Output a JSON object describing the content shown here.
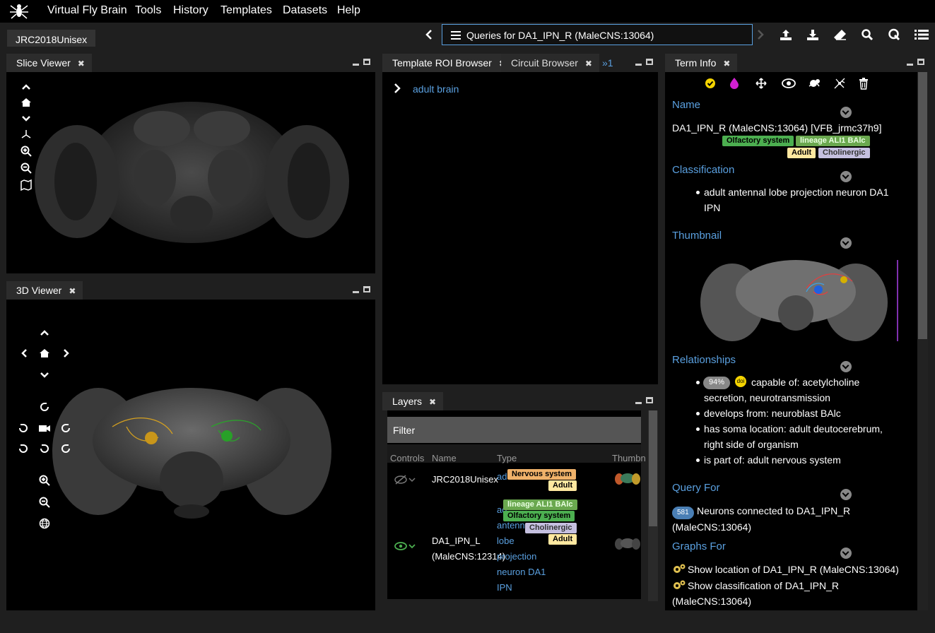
{
  "menu": {
    "app_name": "Virtual Fly Brain",
    "items": [
      "Tools",
      "History",
      "Templates",
      "Datasets",
      "Help"
    ]
  },
  "toolbar": {
    "template_tab": "JRC2018Unisex",
    "query_text": "Queries for DA1_IPN_R (MaleCNS:13064)"
  },
  "slice_viewer": {
    "title": "Slice Viewer"
  },
  "viewer3d": {
    "title": "3D Viewer"
  },
  "roi_browser": {
    "tabs": [
      "Template ROI Browser",
      "Circuit Browser"
    ],
    "overflow": "»1",
    "tree_item": "adult brain"
  },
  "layers": {
    "title": "Layers",
    "filter_label": "Filter",
    "columns": [
      "Controls",
      "Name",
      "Type",
      "Thumbn"
    ],
    "rows": [
      {
        "name": "JRC2018Unisex",
        "type_prefix": "ad",
        "tags": [
          "Nervous system",
          "Adult"
        ]
      },
      {
        "name_line1": "DA1_IPN_L",
        "name_line2": "(MaleCNS:12314)",
        "type_lines": [
          "ad",
          "antenna",
          "lobe",
          "projection",
          "neuron DA1",
          "IPN"
        ],
        "tags": [
          "lineage ALI1 BAlc",
          "Olfactory system",
          "Cholinergic",
          "Adult"
        ]
      }
    ]
  },
  "term_info": {
    "title": "Term Info",
    "name_header": "Name",
    "name_value": "DA1_IPN_R (MaleCNS:13064) [VFB_jrmc37h9]",
    "name_tags": [
      "Olfactory system",
      "lineage ALI1 BAlc",
      "Adult",
      "Cholinergic"
    ],
    "classification_header": "Classification",
    "classification_line1": "adult antennal lobe projection neuron DA1",
    "classification_line2": "IPN",
    "thumbnail_header": "Thumbnail",
    "relationships_header": "Relationships",
    "relationships": {
      "badge_pct": "94%",
      "badge_doi": "doi",
      "r1_line1": "capable of: acetylcholine",
      "r1_line2": "secretion, neurotransmission",
      "r2": "develops from: neuroblast BAlc",
      "r3_line1": "has soma location: adult deutocerebrum,",
      "r3_line2": "right side of organism",
      "r4": "is part of: adult nervous system"
    },
    "query_header": "Query For",
    "query_count": "581",
    "query_line1": "Neurons connected to DA1_IPN_R",
    "query_line2": "(MaleCNS:13064)",
    "graphs_header": "Graphs For",
    "graph1": "Show location of DA1_IPN_R (MaleCNS:13064)",
    "graph2_line1": "Show classification of DA1_IPN_R",
    "graph2_line2": "(MaleCNS:13064)"
  },
  "colors": {
    "accent": "#5aa0e0",
    "tag_olfactory": "#4caf50",
    "tag_lineage": "#6aa84f",
    "tag_adult": "#ffe8a0",
    "tag_cholinergic": "#c5c0e0",
    "tag_nervous": "#f0b26a"
  }
}
